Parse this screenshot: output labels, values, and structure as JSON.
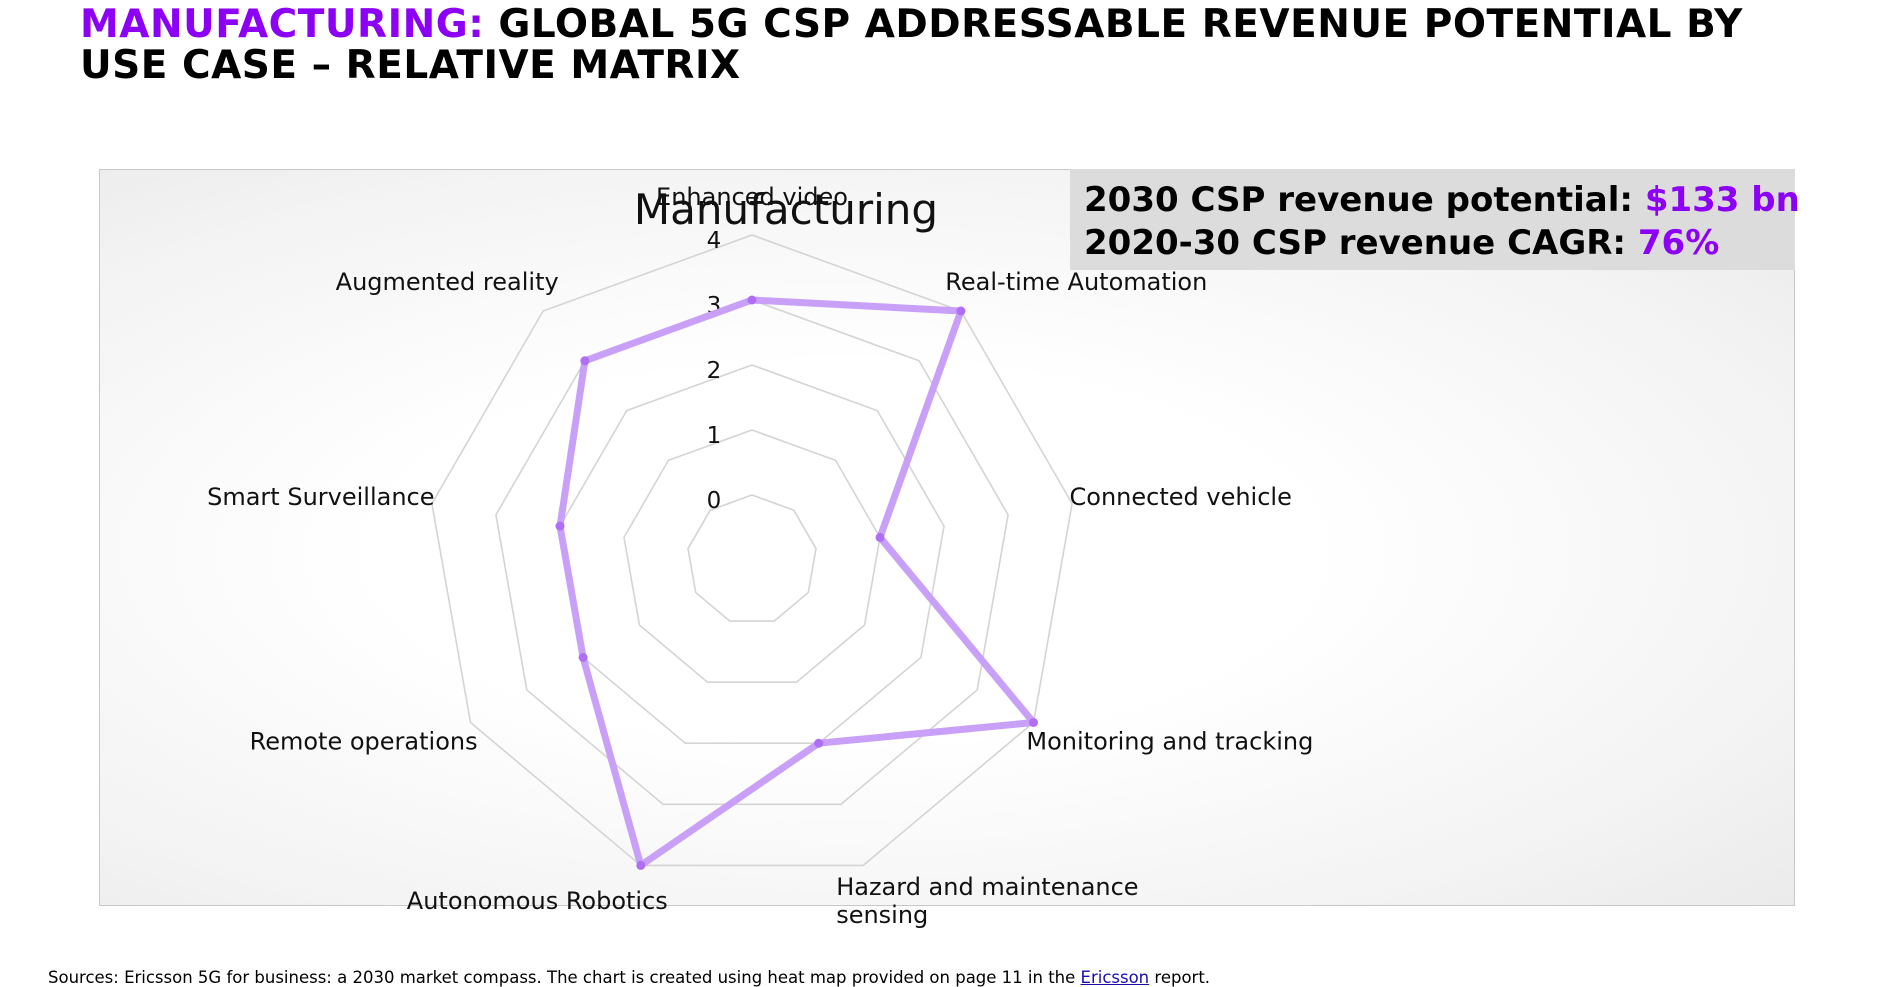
{
  "header": {
    "title_accent": "MANUFACTURING:",
    "title_rest": "GLOBAL 5G CSP ADDRESSABLE REVENUE POTENTIAL BY USE CASE – RELATIVE MATRIX"
  },
  "kpi": {
    "line1_label": "2030 CSP revenue potential:",
    "line1_value": "$133 bn",
    "line2_label": "2020-30 CSP revenue CAGR:",
    "line2_value": "76%"
  },
  "chart_data": {
    "type": "radar",
    "title": "Manufacturing",
    "categories": [
      "Enhanced video",
      "Real-time Automation",
      "Connected vehicle",
      "Monitoring and tracking",
      "Hazard and maintenance sensing",
      "Autonomous Robotics",
      "Remote operations",
      "Smart Surveillance",
      "Augmented reality"
    ],
    "series": [
      {
        "values": [
          3,
          4,
          1,
          4,
          2,
          4,
          2,
          2,
          3
        ]
      }
    ],
    "rlim": [
      0,
      4
    ],
    "r_ticks": [
      "0",
      "1",
      "2",
      "3",
      "4"
    ],
    "grid": true,
    "line_color": "#c9a0f8",
    "marker_color": "#b06ef5"
  },
  "footer": {
    "source_before": "Sources: Ericsson 5G for business: a 2030 market compass. The chart is created using heat map provided on page 11 in the ",
    "source_link": "Ericsson",
    "source_after": " report."
  }
}
